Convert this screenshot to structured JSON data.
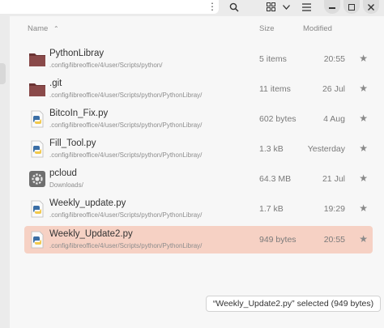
{
  "header": {
    "icons": [
      "kebab-menu-icon",
      "search-icon",
      "view-grid-icon",
      "chevron-down-icon",
      "list-menu-icon",
      "close-icon"
    ],
    "window_buttons": [
      "minimize-icon",
      "maximize-icon",
      "close-icon"
    ]
  },
  "columns": {
    "name": "Name",
    "size": "Size",
    "modified": "Modified"
  },
  "files": [
    {
      "name": "PythonLibray",
      "path": ".config/libreoffice/4/user/Scripts/python/",
      "size": "5 items",
      "modified": "20:55",
      "icon": "folder-icon"
    },
    {
      "name": ".git",
      "path": ".config/libreoffice/4/user/Scripts/python/PythonLibray/",
      "size": "11 items",
      "modified": "26 Jul",
      "icon": "folder-icon"
    },
    {
      "name": "BitcoIn_Fix.py",
      "path": ".config/libreoffice/4/user/Scripts/python/PythonLibray/",
      "size": "602 bytes",
      "modified": "4 Aug",
      "icon": "python-file-icon"
    },
    {
      "name": "Fill_Tool.py",
      "path": ".config/libreoffice/4/user/Scripts/python/PythonLibray/",
      "size": "1.3 kB",
      "modified": "Yesterday",
      "icon": "python-file-icon"
    },
    {
      "name": "pcloud",
      "path": "Downloads/",
      "size": "64.3 MB",
      "modified": "21 Jul",
      "icon": "executable-icon"
    },
    {
      "name": "Weekly_update.py",
      "path": ".config/libreoffice/4/user/Scripts/python/PythonLibray/",
      "size": "1.7 kB",
      "modified": "19:29",
      "icon": "python-file-icon"
    },
    {
      "name": "Weekly_Update2.py",
      "path": ".config/libreoffice/4/user/Scripts/python/PythonLibray/",
      "size": "949 bytes",
      "modified": "20:55",
      "icon": "python-file-icon",
      "selected": true
    }
  ],
  "status": "“Weekly_Update2.py” selected  (949 bytes)",
  "colors": {
    "selection": "#f6d1c4",
    "folder": "#8a4a4a",
    "python_blue": "#3a6ea5",
    "python_yellow": "#f2c94c"
  }
}
